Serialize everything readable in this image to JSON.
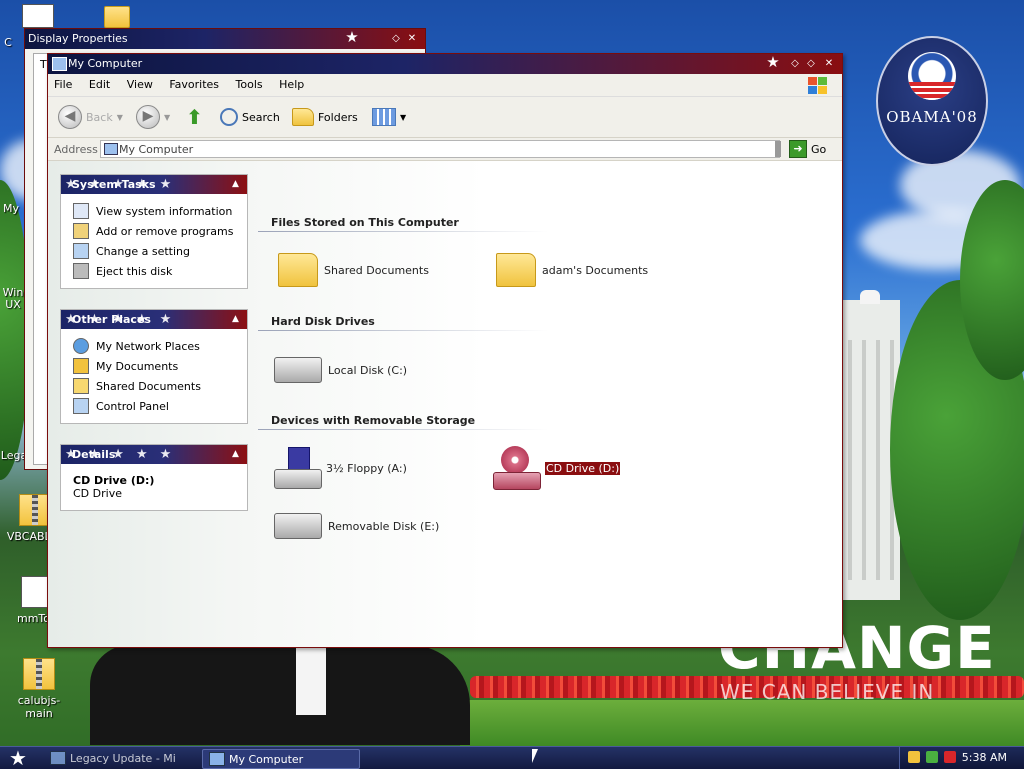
{
  "desktop": {
    "icons": [
      {
        "label": "VBCABLE_"
      },
      {
        "label": "mmTou"
      },
      {
        "label": "calubjs-main"
      }
    ],
    "partial_labels": [
      "C",
      "My",
      "Win",
      "UX",
      "Lega"
    ],
    "wallpaper": {
      "logo_text": "OBAMA'08",
      "slogan": "CHANGE",
      "slogan_sub": "WE CAN BELIEVE IN"
    }
  },
  "display_properties": {
    "title": "Display Properties",
    "tab_hint": "T"
  },
  "window": {
    "title": "My Computer",
    "menu": [
      "File",
      "Edit",
      "View",
      "Favorites",
      "Tools",
      "Help"
    ],
    "toolbar": {
      "back": "Back",
      "search": "Search",
      "folders": "Folders"
    },
    "address": {
      "label": "Address",
      "value": "My Computer",
      "go": "Go"
    },
    "panels": {
      "system_tasks": {
        "title": "System Tasks",
        "items": [
          "View system information",
          "Add or remove programs",
          "Change a setting",
          "Eject this disk"
        ]
      },
      "other_places": {
        "title": "Other Places",
        "items": [
          "My Network Places",
          "My Documents",
          "Shared Documents",
          "Control Panel"
        ]
      },
      "details": {
        "title": "Details",
        "name": "CD Drive (D:)",
        "type": "CD Drive"
      }
    },
    "sections": {
      "files": {
        "title": "Files Stored on This Computer",
        "items": [
          "Shared Documents",
          "adam's Documents"
        ]
      },
      "hard_disks": {
        "title": "Hard Disk Drives",
        "items": [
          "Local Disk (C:)"
        ]
      },
      "removable": {
        "title": "Devices with Removable Storage",
        "items": [
          "3½ Floppy (A:)",
          "CD Drive (D:)",
          "Removable Disk (E:)"
        ]
      }
    }
  },
  "taskbar": {
    "tasks": [
      {
        "label": "Legacy Update - Mi"
      },
      {
        "label": "My Computer"
      }
    ],
    "clock": "5:38 AM"
  },
  "colors": {
    "accent_red": "#8a0e10",
    "accent_blue": "#1b2466"
  }
}
